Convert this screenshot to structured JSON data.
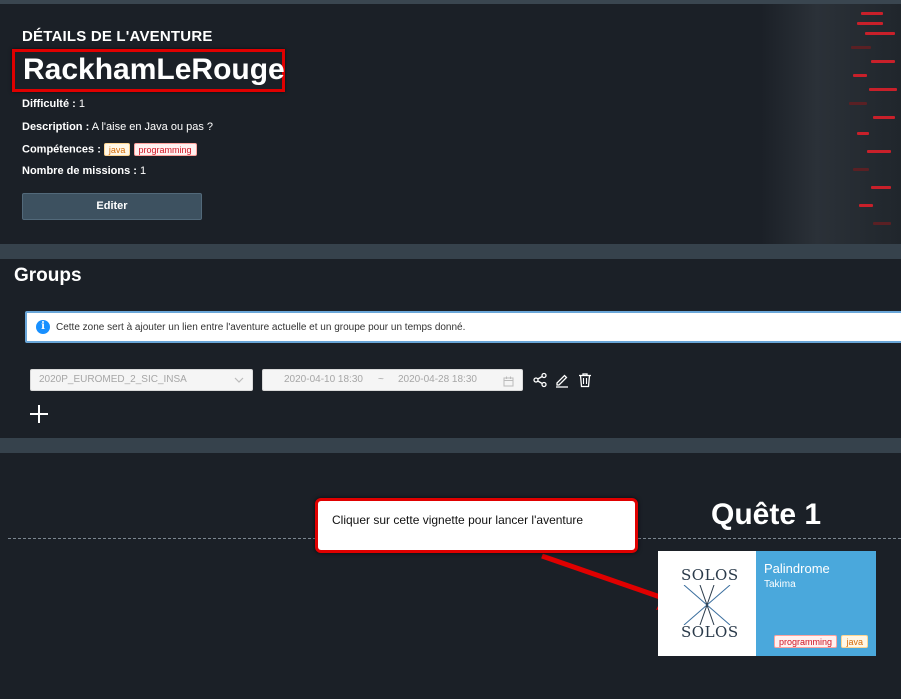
{
  "details": {
    "heading": "DÉTAILS DE L'AVENTURE",
    "title": "RackhamLeRouge",
    "difficulty_label": "Difficulté :",
    "difficulty_value": "1",
    "description_label": "Description :",
    "description_value": "A l'aise en Java ou pas ?",
    "skills_label": "Compétences :",
    "skills": [
      "java",
      "programming"
    ],
    "missions_label": "Nombre de missions :",
    "missions_value": "1",
    "edit_label": "Editer"
  },
  "groups": {
    "title": "Groups",
    "info_text": "Cette zone sert à ajouter un lien entre l'aventure actuelle et un groupe pour un temps donné.",
    "row": {
      "group_value": "2020P_EUROMED_2_SIC_INSA",
      "start": "2020-04-10 18:30",
      "separator": "~",
      "end": "2020-04-28 18:30"
    }
  },
  "quest": {
    "title": "Quête 1",
    "callout_text": "Cliquer sur cette vignette pour lancer l'aventure",
    "card": {
      "image_text_top": "SOLOS",
      "image_text_bottom": "SOLOS",
      "title": "Palindrome",
      "subtitle": "Takima",
      "tags": [
        "programming",
        "java"
      ]
    }
  },
  "colors": {
    "background": "#1b2027",
    "divider": "#36424c",
    "highlight_red": "#e00000",
    "card_blue": "#4aa8dc",
    "info_blue": "#1890ff"
  },
  "icons": [
    "info-icon",
    "chevron-down-icon",
    "calendar-icon",
    "share-icon",
    "edit-icon",
    "trash-icon",
    "plus-icon",
    "arrow-icon"
  ]
}
